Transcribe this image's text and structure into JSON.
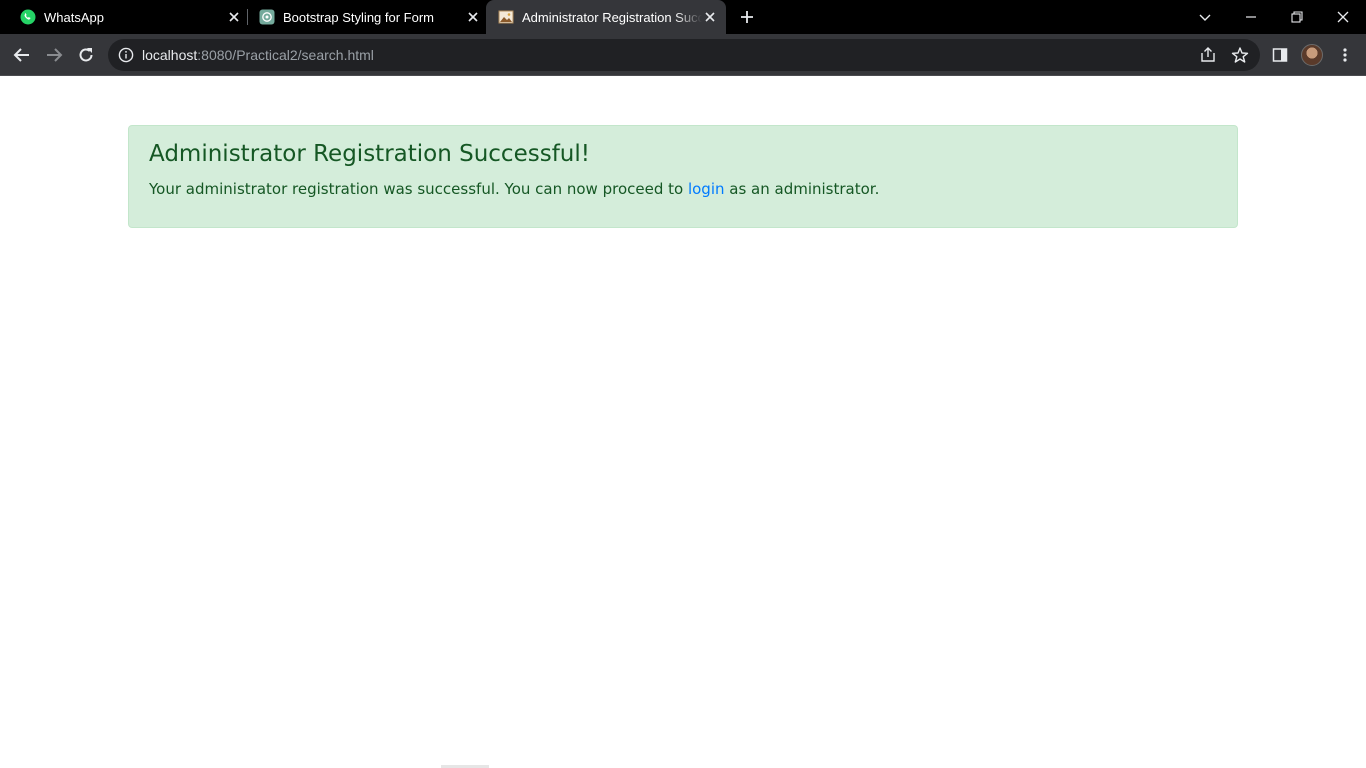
{
  "browser": {
    "tabs": [
      {
        "title": "WhatsApp",
        "icon": "whatsapp-icon"
      },
      {
        "title": "Bootstrap Styling for Form",
        "icon": "chatgpt-icon"
      },
      {
        "title": "Administrator Registration Successful",
        "icon": "page-image-icon",
        "active": true
      }
    ],
    "address": {
      "host": "localhost",
      "path": ":8080/Practical2/search.html"
    }
  },
  "alert": {
    "heading": "Administrator Registration Successful!",
    "text_before": "Your administrator registration was successful. You can now proceed to ",
    "link_label": "login",
    "text_after": " as an administrator."
  },
  "colors": {
    "alert_bg": "#d4edda",
    "alert_text": "#155724",
    "link": "#007bff",
    "toolbar_bg": "#35363a"
  }
}
